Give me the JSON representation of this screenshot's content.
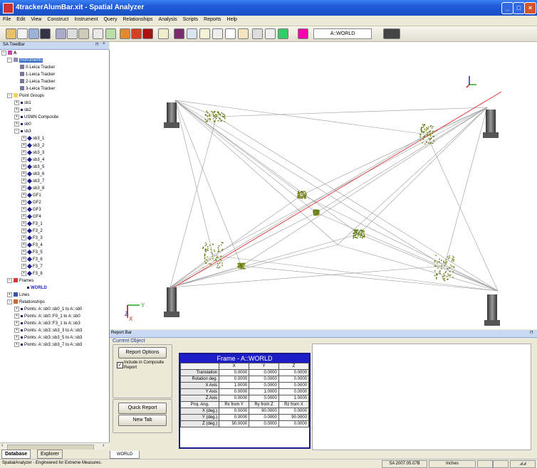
{
  "window": {
    "title": "4trackerAlumBar.xit - Spatial Analyzer"
  },
  "menu": [
    "File",
    "Edit",
    "View",
    "Construct",
    "Instrument",
    "Query",
    "Relationships",
    "Analysis",
    "Scripts",
    "Reports",
    "Help"
  ],
  "toolbar": {
    "frame_field": "A::WORLD"
  },
  "tree": {
    "title": "SA TreeBar",
    "collection": "A",
    "instruments_label": "Instruments",
    "instruments": [
      "0-Leica Tracker",
      "1-Leica Tracker",
      "2-Leica Tracker",
      "3-Leica Tracker"
    ],
    "point_groups_label": "Point Groups",
    "point_groups": [
      "sb1",
      "sb2",
      "USMN Composite",
      "sb0",
      "sb3"
    ],
    "sb3_children": [
      "sb3_1",
      "sb3_2",
      "sb3_3",
      "sb3_4",
      "sb3_5",
      "sb3_6",
      "sb3_7",
      "sb3_8",
      "GF1",
      "GF2",
      "GF3",
      "GF4",
      "F3_1",
      "F3_2",
      "F3_3",
      "F3_4",
      "F3_5",
      "F3_6",
      "F3_7",
      "F3_8"
    ],
    "frames_label": "Frames",
    "world_label": "WORLD",
    "lines_label": "Lines",
    "relationships_label": "Relationships",
    "relationships": [
      "Points: A::sb0::sb0_1 to A::sb0",
      "Points: A::sb0::F0_1 to A::sb0",
      "Points: A::sb3::F3_1 to A::sb3",
      "Points: A::sb3::sb3_3 to A::sb3",
      "Points: A::sb3::sb3_5 to A::sb3",
      "Points: A::sb3::sb3_7 to A::sb3"
    ],
    "tab_database": "Database",
    "tab_explorer": "Explorer"
  },
  "report": {
    "title": "Report Bar",
    "current_object": "Current Object",
    "report_options": "Report Options",
    "include_composite": "Include in Composite Report",
    "quick_report": "Quick Report",
    "new_tab": "New Tab",
    "tab_label": "WORLD",
    "frame_title": "Frame - A::WORLD",
    "col_headers": [
      "X",
      "Y",
      "Z"
    ],
    "rows": [
      {
        "label": "Translation",
        "vals": [
          "0.0000",
          "0.0000",
          "0.0000"
        ]
      },
      {
        "label": "Rotation deg.",
        "vals": [
          "0.0000",
          "0.0000",
          "0.0000"
        ]
      },
      {
        "label": "X Axis",
        "vals": [
          "1.0000",
          "0.0000",
          "0.0000"
        ]
      },
      {
        "label": "Y Axis",
        "vals": [
          "0.0000",
          "1.0000",
          "0.0000"
        ]
      },
      {
        "label": "Z Axis",
        "vals": [
          "0.0000",
          "0.0000",
          "1.0000"
        ]
      }
    ],
    "proj_headers": [
      "Proj. Ang.",
      "Rx from Y",
      "Ry from Z",
      "Rz from X"
    ],
    "proj_rows": [
      {
        "label": "X (deg.)",
        "vals": [
          "0.0000",
          "90.0000",
          "0.0000"
        ]
      },
      {
        "label": "Y (deg.)",
        "vals": [
          "0.0000",
          "0.0000",
          "90.0000"
        ]
      },
      {
        "label": "Z (deg.)",
        "vals": [
          "90.0000",
          "0.0000",
          "0.0000"
        ]
      }
    ]
  },
  "status": {
    "left": "SpatialAnalyzer - Engineered for Extreme Measures.",
    "version": "SA 2007.05.07B",
    "units": "Inches"
  },
  "axes": {
    "z": "Z",
    "y": "Y",
    "x": "X"
  },
  "colors": {
    "selection": "#316ac5",
    "titlebar": "#1f5bd6",
    "red_line": "#e02020"
  }
}
